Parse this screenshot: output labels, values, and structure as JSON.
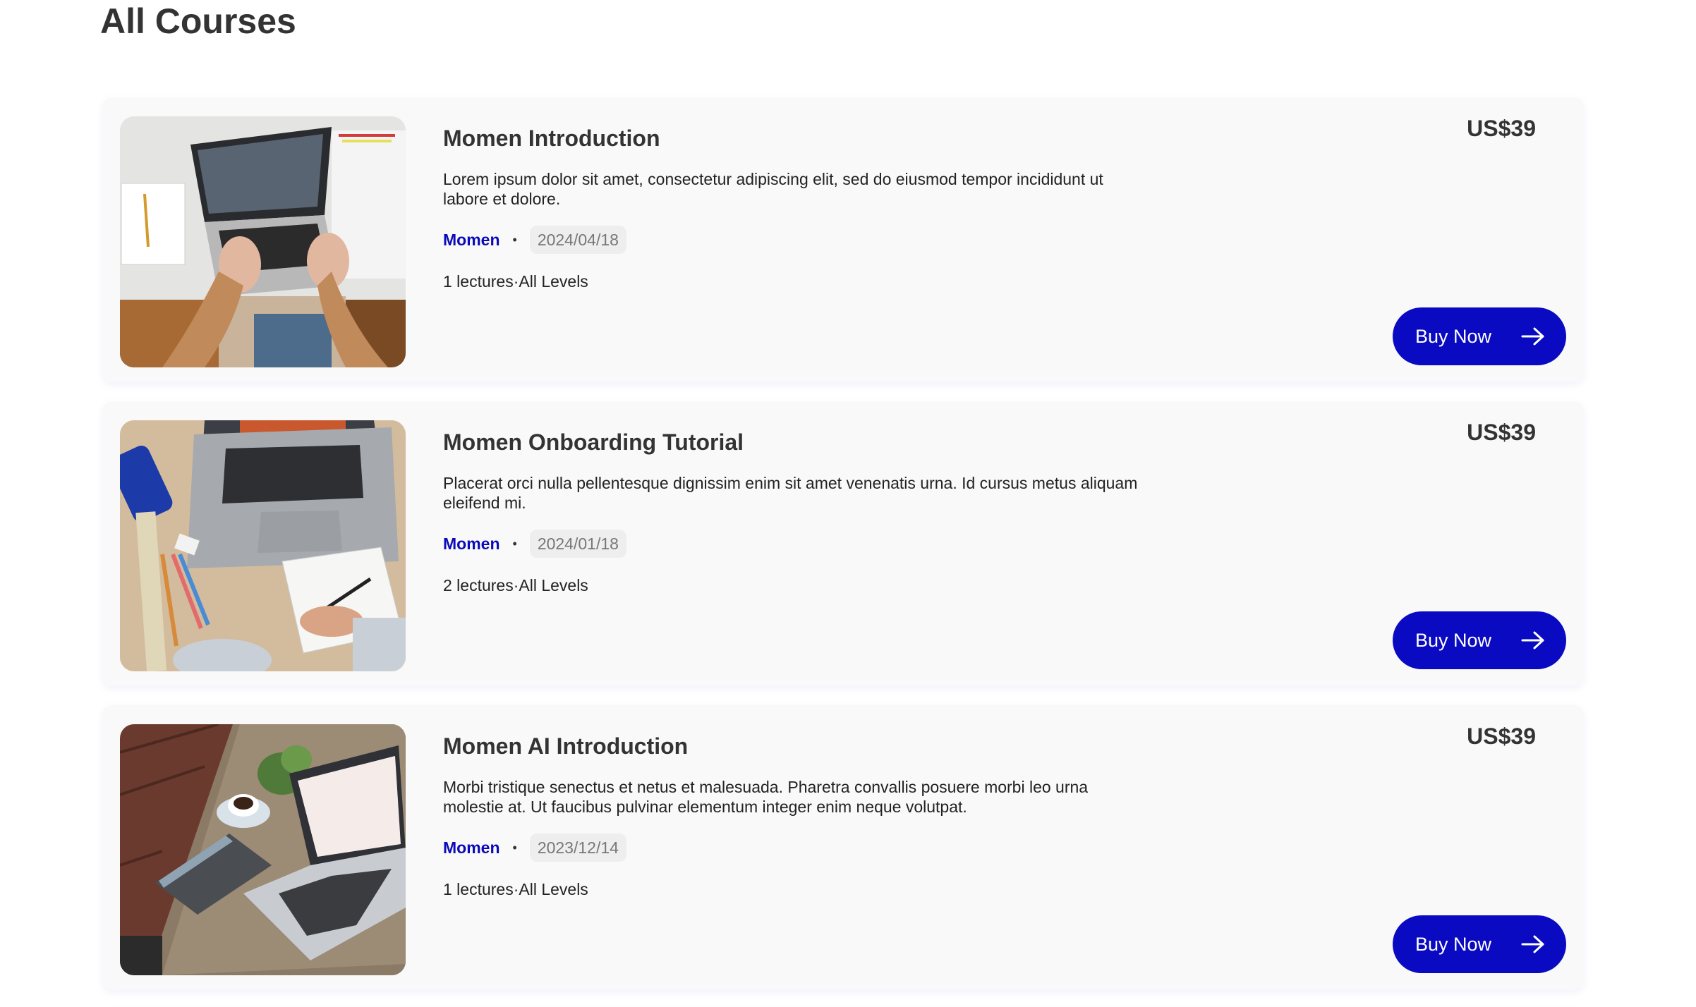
{
  "page": {
    "title": "All Courses"
  },
  "colors": {
    "accent": "#0a0ac2",
    "author_link": "#0a0ab8",
    "card_background": "#f9f9f9",
    "date_badge_background": "#eeeeee"
  },
  "courses": [
    {
      "title": "Momen Introduction",
      "description": "Lorem ipsum dolor sit amet, consectetur adipiscing elit, sed do eiusmod tempor incididunt ut labore et dolore.",
      "author": "Momen",
      "date": "2024/04/18",
      "lectures_info": "1 lectures·All Levels",
      "price": "US$39",
      "buy_label": "Buy Now",
      "thumbnail_icon": "laptop-typing-photo"
    },
    {
      "title": "Momen Onboarding Tutorial",
      "description": "Placerat orci nulla pellentesque dignissim enim sit amet venenatis urna. Id cursus metus aliquam eleifend mi.",
      "author": "Momen",
      "date": "2024/01/18",
      "lectures_info": "2 lectures·All Levels",
      "price": "US$39",
      "buy_label": "Buy Now",
      "thumbnail_icon": "laptop-notebook-desk-photo"
    },
    {
      "title": "Momen AI Introduction",
      "description": "Morbi tristique senectus et netus et malesuada. Pharetra convallis posuere morbi leo urna molestie at. Ut faucibus pulvinar elementum integer enim neque volutpat.",
      "author": "Momen",
      "date": "2023/12/14",
      "lectures_info": "1 lectures·All Levels",
      "price": "US$39",
      "buy_label": "Buy Now",
      "thumbnail_icon": "laptop-coffee-table-photo"
    }
  ]
}
